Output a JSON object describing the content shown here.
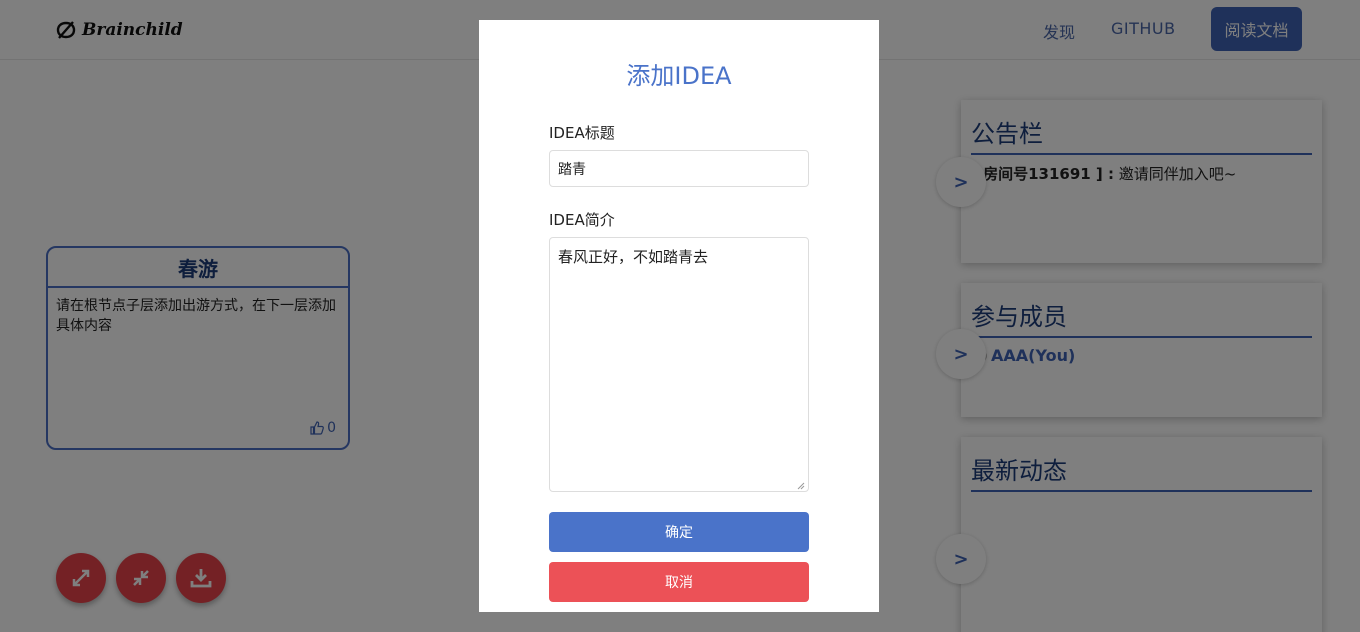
{
  "header": {
    "brand": "Brainchild",
    "nav_discover": "发现",
    "nav_github": "GITHUB",
    "nav_docs": "阅读文档"
  },
  "node": {
    "title": "春游",
    "description": "请在根节点子层添加出游方式，在下一层添加具体内容",
    "likes": "0"
  },
  "sidebar": {
    "bulletin": {
      "title": "公告栏",
      "room_prefix": "[ 房间号131691 ] :",
      "message": "邀请同伴加入吧~"
    },
    "members": {
      "title": "参与成员",
      "items": [
        "AAA(You)"
      ]
    },
    "activity": {
      "title": "最新动态"
    },
    "expand_symbol": ">"
  },
  "modal": {
    "title": "添加IDEA",
    "title_label": "IDEA标题",
    "title_value": "踏青",
    "desc_label": "IDEA简介",
    "desc_value": "春风正好，不如踏青去",
    "confirm": "确定",
    "cancel": "取消"
  },
  "colors": {
    "primary": "#4a73c9",
    "danger": "#ec5157",
    "dark_blue": "#1d3c7a"
  }
}
